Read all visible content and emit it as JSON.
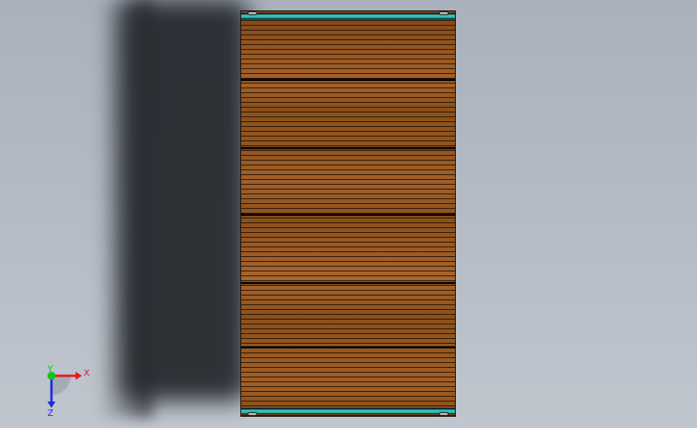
{
  "viewport": {
    "background": "#b4bbc5",
    "shadow_color": "#272b30"
  },
  "model": {
    "panel_color": "#9a5a22",
    "line_color": "#2a1607",
    "rail_color": "#39d7d0"
  },
  "triad": {
    "x_label": "X",
    "y_label": "Y",
    "z_label": "Z",
    "x_color": "#e81b1b",
    "y_color": "#14c21c",
    "z_color": "#1b2fe0"
  }
}
